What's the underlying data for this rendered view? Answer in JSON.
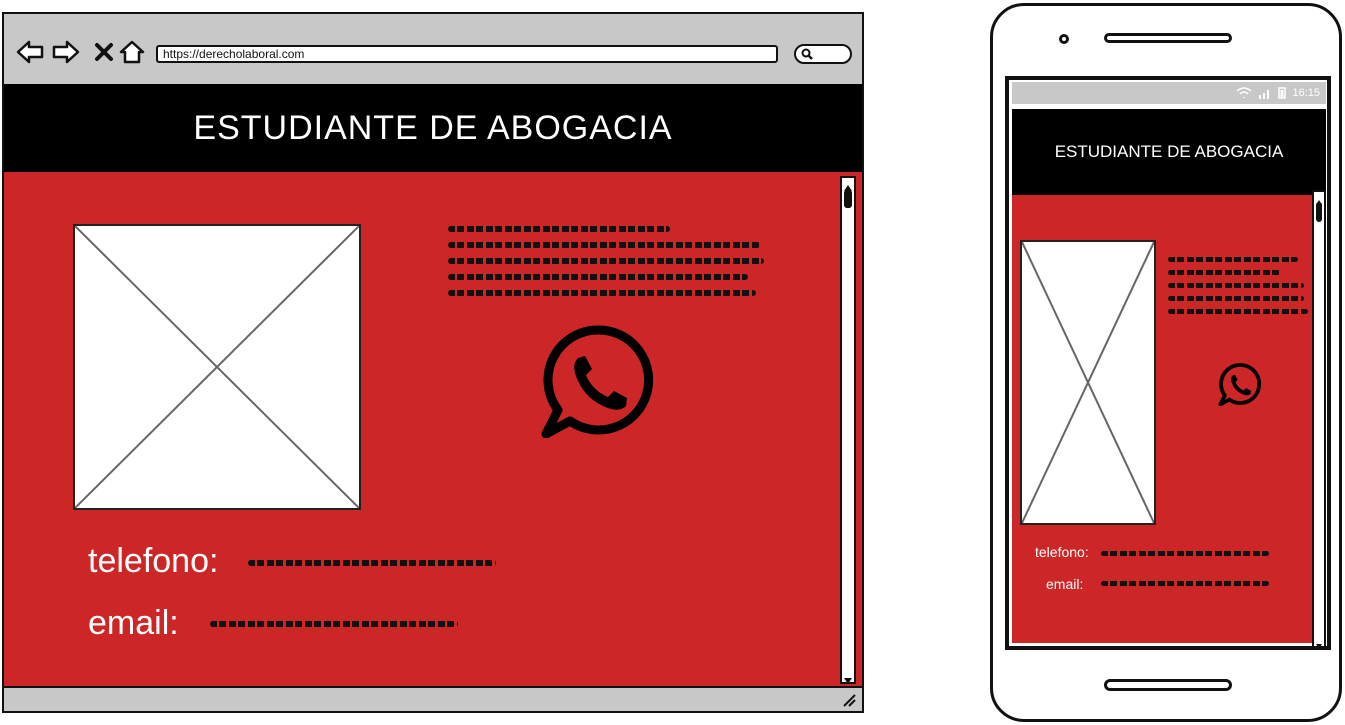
{
  "desktop": {
    "url": "https://derecholaboral.com",
    "header_title": "ESTUDIANTE DE ABOGACIA",
    "phone_label": "telefono:",
    "email_label": "email:"
  },
  "mobile": {
    "status_time": "16:15",
    "header_title": "ESTUDIANTE DE ABOGACIA",
    "phone_label": "telefono:",
    "email_label": "email:"
  },
  "colors": {
    "body_red": "#cd2626",
    "header_black": "#000000",
    "chrome_gray": "#c8c8c8"
  },
  "icons": [
    "back-arrow-icon",
    "forward-arrow-icon",
    "close-icon",
    "home-icon",
    "search-icon",
    "whatsapp-icon",
    "wifi-icon",
    "signal-icon",
    "battery-icon"
  ]
}
